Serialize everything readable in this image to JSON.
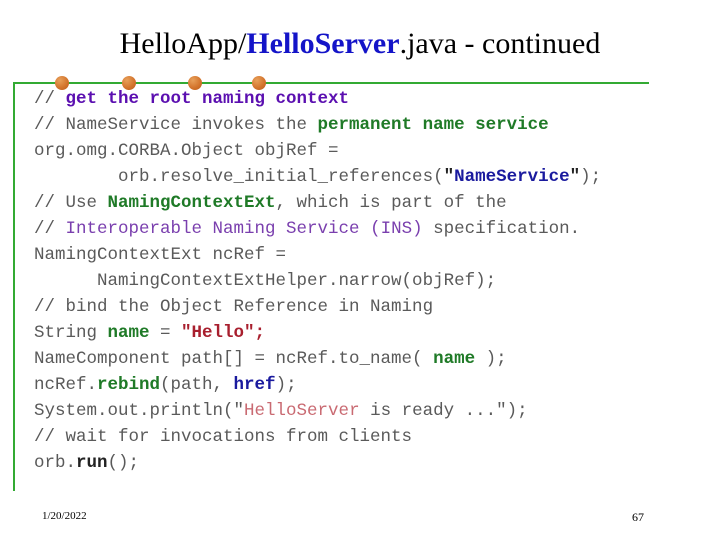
{
  "slide": {
    "title": {
      "prefix": "HelloApp/",
      "highlight": "HelloServer",
      "suffix": ".java - continued",
      "highlight_color": "#1414c8"
    },
    "decoration": {
      "line_color": "#33aa33",
      "bullet_color": "#d97a2b",
      "bullet_count": 4,
      "bullet_positions": [
        55,
        122,
        188,
        252
      ]
    },
    "code_lines": [
      {
        "id": "line-1",
        "spans": [
          {
            "text": "// ",
            "style": "gray"
          },
          {
            "text": "get the root naming context",
            "style": "purple-bold"
          }
        ]
      },
      {
        "id": "line-2",
        "spans": [
          {
            "text": "// NameService invokes the ",
            "style": "gray"
          },
          {
            "text": "permanent name service",
            "style": "green-bold"
          }
        ]
      },
      {
        "id": "line-3",
        "spans": [
          {
            "text": "org.omg.CORBA.Object objRef =",
            "style": "gray"
          }
        ]
      },
      {
        "id": "line-4",
        "spans": [
          {
            "text": "        orb.resolve_initial_references(",
            "style": "gray"
          },
          {
            "text": "\"",
            "style": "dark-bold"
          },
          {
            "text": "NameService",
            "style": "blue-bold"
          },
          {
            "text": "\"",
            "style": "dark-bold"
          },
          {
            "text": ");",
            "style": "gray"
          }
        ]
      },
      {
        "id": "line-5",
        "spans": [
          {
            "text": "// Use ",
            "style": "gray"
          },
          {
            "text": "NamingContextExt",
            "style": "green-bold"
          },
          {
            "text": ", which is part of the",
            "style": "gray"
          }
        ]
      },
      {
        "id": "line-6",
        "spans": [
          {
            "text": "// ",
            "style": "gray"
          },
          {
            "text": "Interoperable Naming Service (INS)",
            "style": "purple"
          },
          {
            "text": " specification.",
            "style": "gray"
          }
        ]
      },
      {
        "id": "line-7",
        "spans": [
          {
            "text": "NamingContextExt ncRef =",
            "style": "gray"
          }
        ]
      },
      {
        "id": "line-8",
        "spans": [
          {
            "text": "      NamingContextExtHelper.narrow(objRef);",
            "style": "gray"
          }
        ]
      },
      {
        "id": "line-9",
        "spans": [
          {
            "text": "// bind the Object Reference in Naming",
            "style": "gray"
          }
        ]
      },
      {
        "id": "line-10",
        "spans": [
          {
            "text": "String ",
            "style": "gray"
          },
          {
            "text": "name",
            "style": "green-bold"
          },
          {
            "text": " = ",
            "style": "gray"
          },
          {
            "text": "\"Hello\";",
            "style": "red-bold"
          }
        ]
      },
      {
        "id": "line-11",
        "spans": [
          {
            "text": "NameComponent path[] = ncRef.to_name( ",
            "style": "gray"
          },
          {
            "text": "name",
            "style": "green-bold"
          },
          {
            "text": " );",
            "style": "gray"
          }
        ]
      },
      {
        "id": "line-12",
        "spans": [
          {
            "text": "ncRef.",
            "style": "gray"
          },
          {
            "text": "rebind",
            "style": "green-bold"
          },
          {
            "text": "(path, ",
            "style": "gray"
          },
          {
            "text": "href",
            "style": "blue-bold"
          },
          {
            "text": ");",
            "style": "gray"
          }
        ]
      },
      {
        "id": "line-13",
        "spans": [
          {
            "text": "System.out.println(\"",
            "style": "gray"
          },
          {
            "text": "HelloServer",
            "style": "salmon"
          },
          {
            "text": " is ready ...\");",
            "style": "gray"
          }
        ]
      },
      {
        "id": "line-14",
        "spans": [
          {
            "text": "// wait for invocations from clients",
            "style": "gray"
          }
        ]
      },
      {
        "id": "line-15",
        "spans": [
          {
            "text": "orb.",
            "style": "gray"
          },
          {
            "text": "run",
            "style": "dark-bold"
          },
          {
            "text": "();",
            "style": "gray"
          }
        ]
      }
    ],
    "footer": {
      "date": "1/20/2022",
      "page_number": "67"
    }
  }
}
